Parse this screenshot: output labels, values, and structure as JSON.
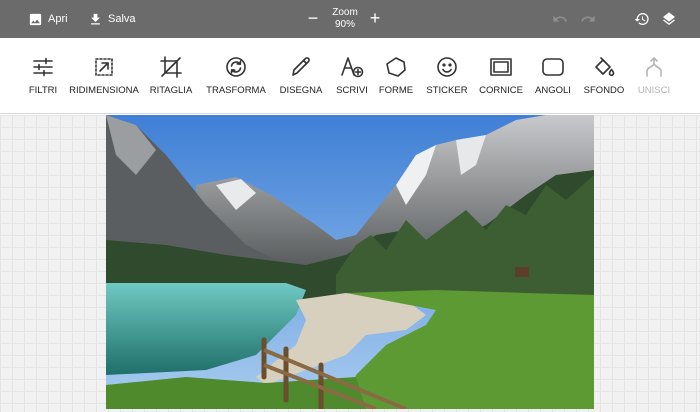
{
  "topbar": {
    "open_label": "Apri",
    "save_label": "Salva",
    "zoom_label": "Zoom",
    "zoom_value": "90%",
    "zoom_out_symbol": "−",
    "zoom_in_symbol": "+",
    "icons": [
      "image-icon",
      "download-icon",
      "undo-icon",
      "redo-icon",
      "history-icon",
      "layers-icon"
    ]
  },
  "tools": [
    {
      "label": "FILTRI",
      "icon": "sliders-icon",
      "enabled": true
    },
    {
      "label": "RIDIMENSIONA",
      "icon": "resize-icon",
      "enabled": true
    },
    {
      "label": "RITAGLIA",
      "icon": "crop-icon",
      "enabled": true
    },
    {
      "label": "TRASFORMA",
      "icon": "rotate-icon",
      "enabled": true
    },
    {
      "label": "DISEGNA",
      "icon": "pencil-icon",
      "enabled": true
    },
    {
      "label": "SCRIVI",
      "icon": "text-add-icon",
      "enabled": true
    },
    {
      "label": "FORME",
      "icon": "shape-icon",
      "enabled": true
    },
    {
      "label": "STICKER",
      "icon": "smiley-icon",
      "enabled": true
    },
    {
      "label": "CORNICE",
      "icon": "frame-icon",
      "enabled": true
    },
    {
      "label": "ANGOLI",
      "icon": "rounded-corner-icon",
      "enabled": true
    },
    {
      "label": "SFONDO",
      "icon": "paint-bucket-icon",
      "enabled": true
    },
    {
      "label": "UNISCI",
      "icon": "merge-icon",
      "enabled": false
    }
  ],
  "colors": {
    "topbar_bg": "#6b6b6b",
    "icon_disabled": "#b5b5b5",
    "workspace_bg": "#f1f1f1"
  }
}
